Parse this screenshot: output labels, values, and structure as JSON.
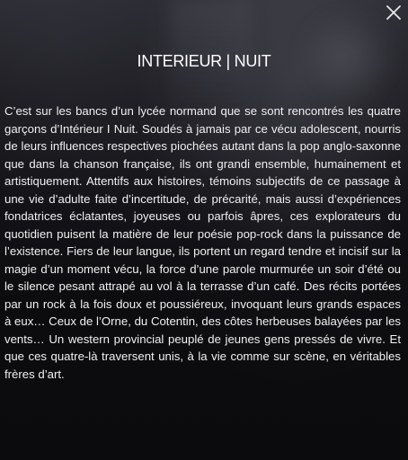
{
  "modal": {
    "title": "INTERIEUR | NUIT",
    "description": "C’est sur les bancs d’un lycée normand que se sont rencontrés les quatre garçons d’Intérieur I Nuit. Soudés à jamais par ce vécu adolescent, nourris de leurs influences respectives piochées autant dans la pop anglo-saxonne que dans la chanson française, ils ont grandi ensemble, humainement et artistiquement. Attentifs aux histoires, témoins subjectifs de ce passage à une vie d’adulte faite d’incertitude, de précarité, mais aussi d’expériences fondatrices éclatantes, joyeuses ou parfois âpres, ces explorateurs du quotidien puisent la matière de leur poésie pop-rock dans la puissance de l’existence. Fiers de leur langue, ils portent un regard tendre et incisif sur la magie d’un moment vécu, la force d’une parole murmurée un soir d’été ou le silence pesant attrapé au vol à la terrasse d’un café. Des récits portées par un rock à la fois doux et poussiéreux, invoquant leurs grands espaces à eux… Ceux de l’Orne, du Cotentin, des côtes herbeuses balayées par les vents… Un western provincial peuplé de jeunes gens pressés de vivre. Et que ces quatre-là traversent unis, à la vie comme sur scène, en véritables frères d’art.",
    "close_icon": "close-icon"
  },
  "colors": {
    "text": "#f0f0f0",
    "background": "#0e0e11"
  }
}
